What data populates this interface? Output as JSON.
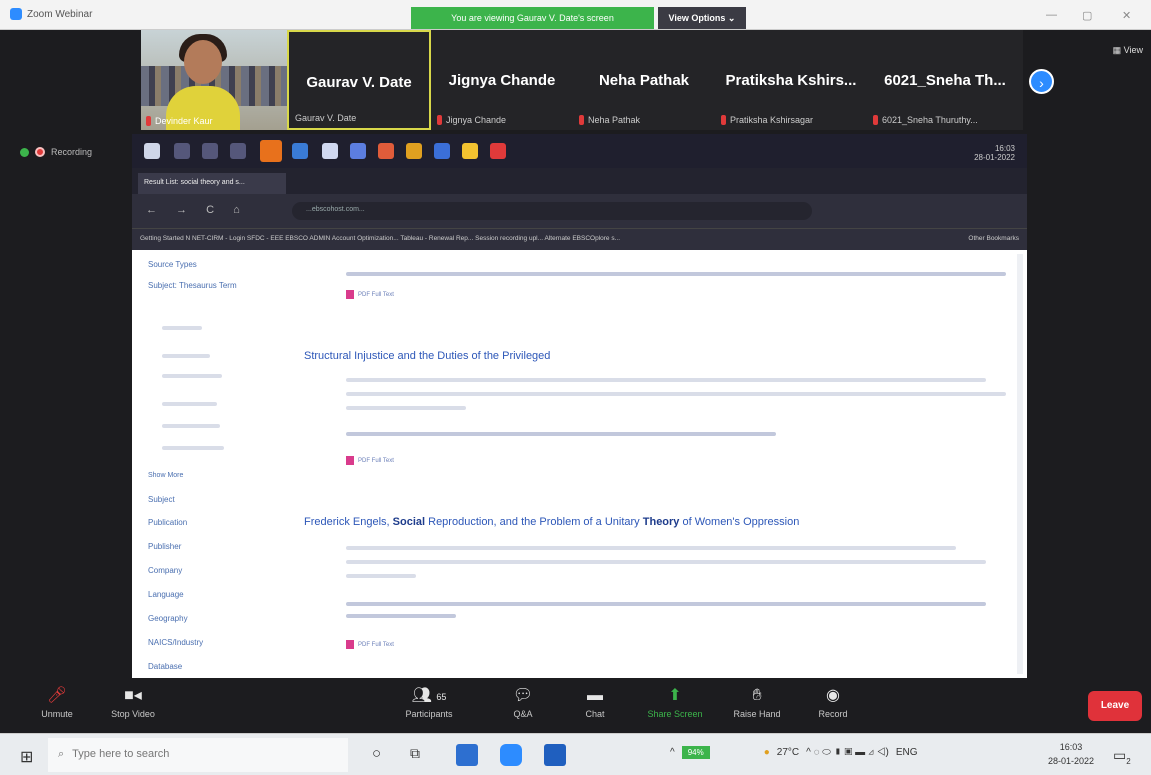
{
  "window": {
    "app_title": "Zoom Webinar"
  },
  "banner": {
    "viewing": "You are viewing Gaurav V. Date's screen",
    "view_options": "View Options ⌄"
  },
  "view_label": "View",
  "participants": [
    {
      "display": "",
      "name": "Devinder Kaur"
    },
    {
      "display": "Gaurav V. Date",
      "name": "Gaurav V. Date"
    },
    {
      "display": "Jignya Chande",
      "name": "Jignya Chande"
    },
    {
      "display": "Neha Pathak",
      "name": "Neha Pathak"
    },
    {
      "display": "Pratiksha Kshirs...",
      "name": "Pratiksha Kshirsagar"
    },
    {
      "display": "6021_Sneha Th...",
      "name": "6021_Sneha Thuruthy..."
    }
  ],
  "recording": "Recording",
  "shared": {
    "tab": "Result List: social theory and s...",
    "url": "...ebscohost.com...",
    "bookmarks": "Getting Started   N NET-CIRM - Login   SFDC - EEE   EBSCO ADMIN   Account Optimization...   Tableau - Renewal Rep...   Session recording upl...   Alternate EBSCOplore s...",
    "other_bookmarks": "Other Bookmarks",
    "clock_time": "16:03",
    "clock_date": "28-01-2022",
    "facets": [
      "Source Types",
      "Subject: Thesaurus Term",
      "Show More",
      "Subject",
      "Publication",
      "Publisher",
      "Company",
      "Language",
      "Geography",
      "NAICS/Industry",
      "Database"
    ],
    "pdf_label": "PDF Full Text",
    "results": [
      {
        "pre": "Structural Injustice and the Duties of the Privileged",
        "bold1": "",
        "mid": "",
        "bold2": "",
        "post": ""
      },
      {
        "pre": "Frederick Engels, ",
        "bold1": "Social",
        "mid": " Reproduction, and the Problem of a Unitary ",
        "bold2": "Theory",
        "post": " of Women's Oppression"
      }
    ]
  },
  "toolbar": {
    "unmute": "Unmute",
    "stop_video": "Stop Video",
    "participants": "Participants",
    "participant_count": "65",
    "qa": "Q&A",
    "chat": "Chat",
    "share_screen": "Share Screen",
    "raise_hand": "Raise Hand",
    "record": "Record",
    "leave": "Leave"
  },
  "taskbar": {
    "search_placeholder": "Type here to search",
    "battery": "94%",
    "temperature": "27°C",
    "lang": "ENG",
    "time": "16:03",
    "date": "28-01-2022",
    "notifications": "2"
  }
}
